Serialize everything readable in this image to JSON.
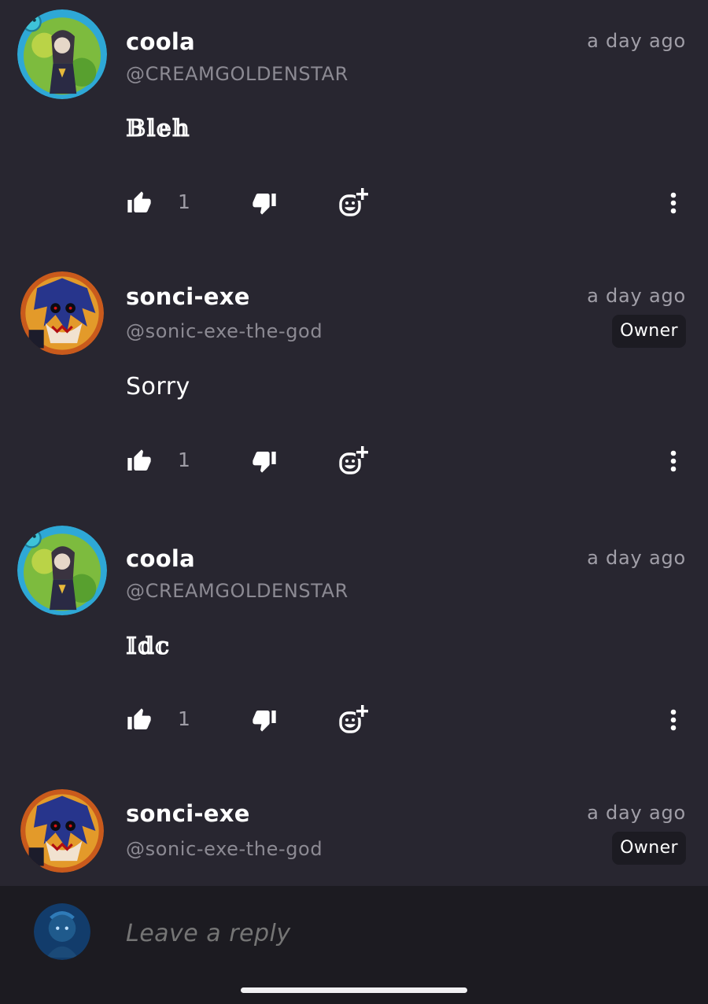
{
  "comments": [
    {
      "display_name": "coola",
      "handle": "@CREAMGOLDENSTAR",
      "time": "a day ago",
      "badge": "",
      "text": "𝔹𝕝𝕖𝕙",
      "likes": "1",
      "avatar": "coola-avatar"
    },
    {
      "display_name": "sonci-exe",
      "handle": "@sonic-exe-the-god",
      "time": "a day ago",
      "badge": "Owner",
      "text": "Sorry",
      "likes": "1",
      "avatar": "sonci-avatar"
    },
    {
      "display_name": "coola",
      "handle": "@CREAMGOLDENSTAR",
      "time": "a day ago",
      "badge": "",
      "text": "𝕀𝕕𝕔",
      "likes": "1",
      "avatar": "coola-avatar"
    },
    {
      "display_name": "sonci-exe",
      "handle": "@sonic-exe-the-god",
      "time": "a day ago",
      "badge": "Owner",
      "text": "",
      "likes": "",
      "avatar": "sonci-avatar"
    }
  ],
  "reply": {
    "placeholder": "Leave a reply"
  },
  "icons": {
    "like": "thumbs-up-icon",
    "dislike": "thumbs-down-icon",
    "react": "add-reaction-icon",
    "more": "more-vertical-icon"
  },
  "colors": {
    "background": "#282630",
    "reply_bar": "#1c1b21",
    "badge_bg": "#1c1b22",
    "muted_text": "#8c8a93"
  }
}
